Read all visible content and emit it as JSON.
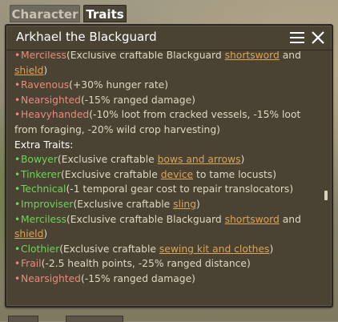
{
  "tabs": [
    {
      "label": "Character",
      "active": false
    },
    {
      "label": "Traits",
      "active": true
    }
  ],
  "window": {
    "title": "Arkhael the Blackguard",
    "menu_icon": "hamburger-menu-icon",
    "close_icon": "close-icon"
  },
  "colors": {
    "positive_trait": "#6fd25a",
    "negative_trait": "#ea8a7c",
    "link": "#dba457",
    "text": "#ded8c5"
  },
  "traits_top": [
    {
      "name": "Merciless",
      "type": "negative",
      "pre": "(Exclusive craftable Blackguard ",
      "link1": "shortsword",
      "mid": " and",
      "cont_link": "shield",
      "cont_post": ")"
    },
    {
      "name": "Ravenous",
      "type": "negative",
      "desc": "(+30% hunger rate)"
    },
    {
      "name": "Nearsighted",
      "type": "negative",
      "desc": "(-15% ranged damage)"
    },
    {
      "name": "Heavyhanded",
      "type": "negative",
      "desc": "(-10% loot from cracked vessels, -15% loot",
      "cont": "from foraging, -20% wild crop harvesting)"
    }
  ],
  "extra_traits_header": "Extra Traits:",
  "extra_traits": [
    {
      "name": "Bowyer",
      "type": "positive",
      "pre": "(Exclusive craftable ",
      "link": "bows and arrows",
      "post": ")"
    },
    {
      "name": "Tinkerer",
      "type": "positive",
      "pre": "(Exclusive craftable ",
      "link": "device",
      "post": " to tame locusts)"
    },
    {
      "name": "Technical",
      "type": "positive",
      "desc": "(-1 temporal gear cost to repair translocators)"
    },
    {
      "name": "Improviser",
      "type": "positive",
      "pre": "(Exclusive craftable ",
      "link": "sling",
      "post": ")"
    },
    {
      "name": "Merciless",
      "type": "positive",
      "pre": "(Exclusive craftable Blackguard ",
      "link": "shortsword",
      "post": " and",
      "cont_link": "shield",
      "cont_post": ")"
    },
    {
      "name": "Clothier",
      "type": "positive",
      "pre": "(Exclusive craftable ",
      "link": "sewing kit and clothes",
      "post": ")"
    },
    {
      "name": "Frail",
      "type": "negative",
      "desc": "(-2.5 health points, -25% ranged distance)"
    },
    {
      "name": "Nearsighted",
      "type": "negative",
      "desc": "(-15% ranged damage)"
    }
  ]
}
